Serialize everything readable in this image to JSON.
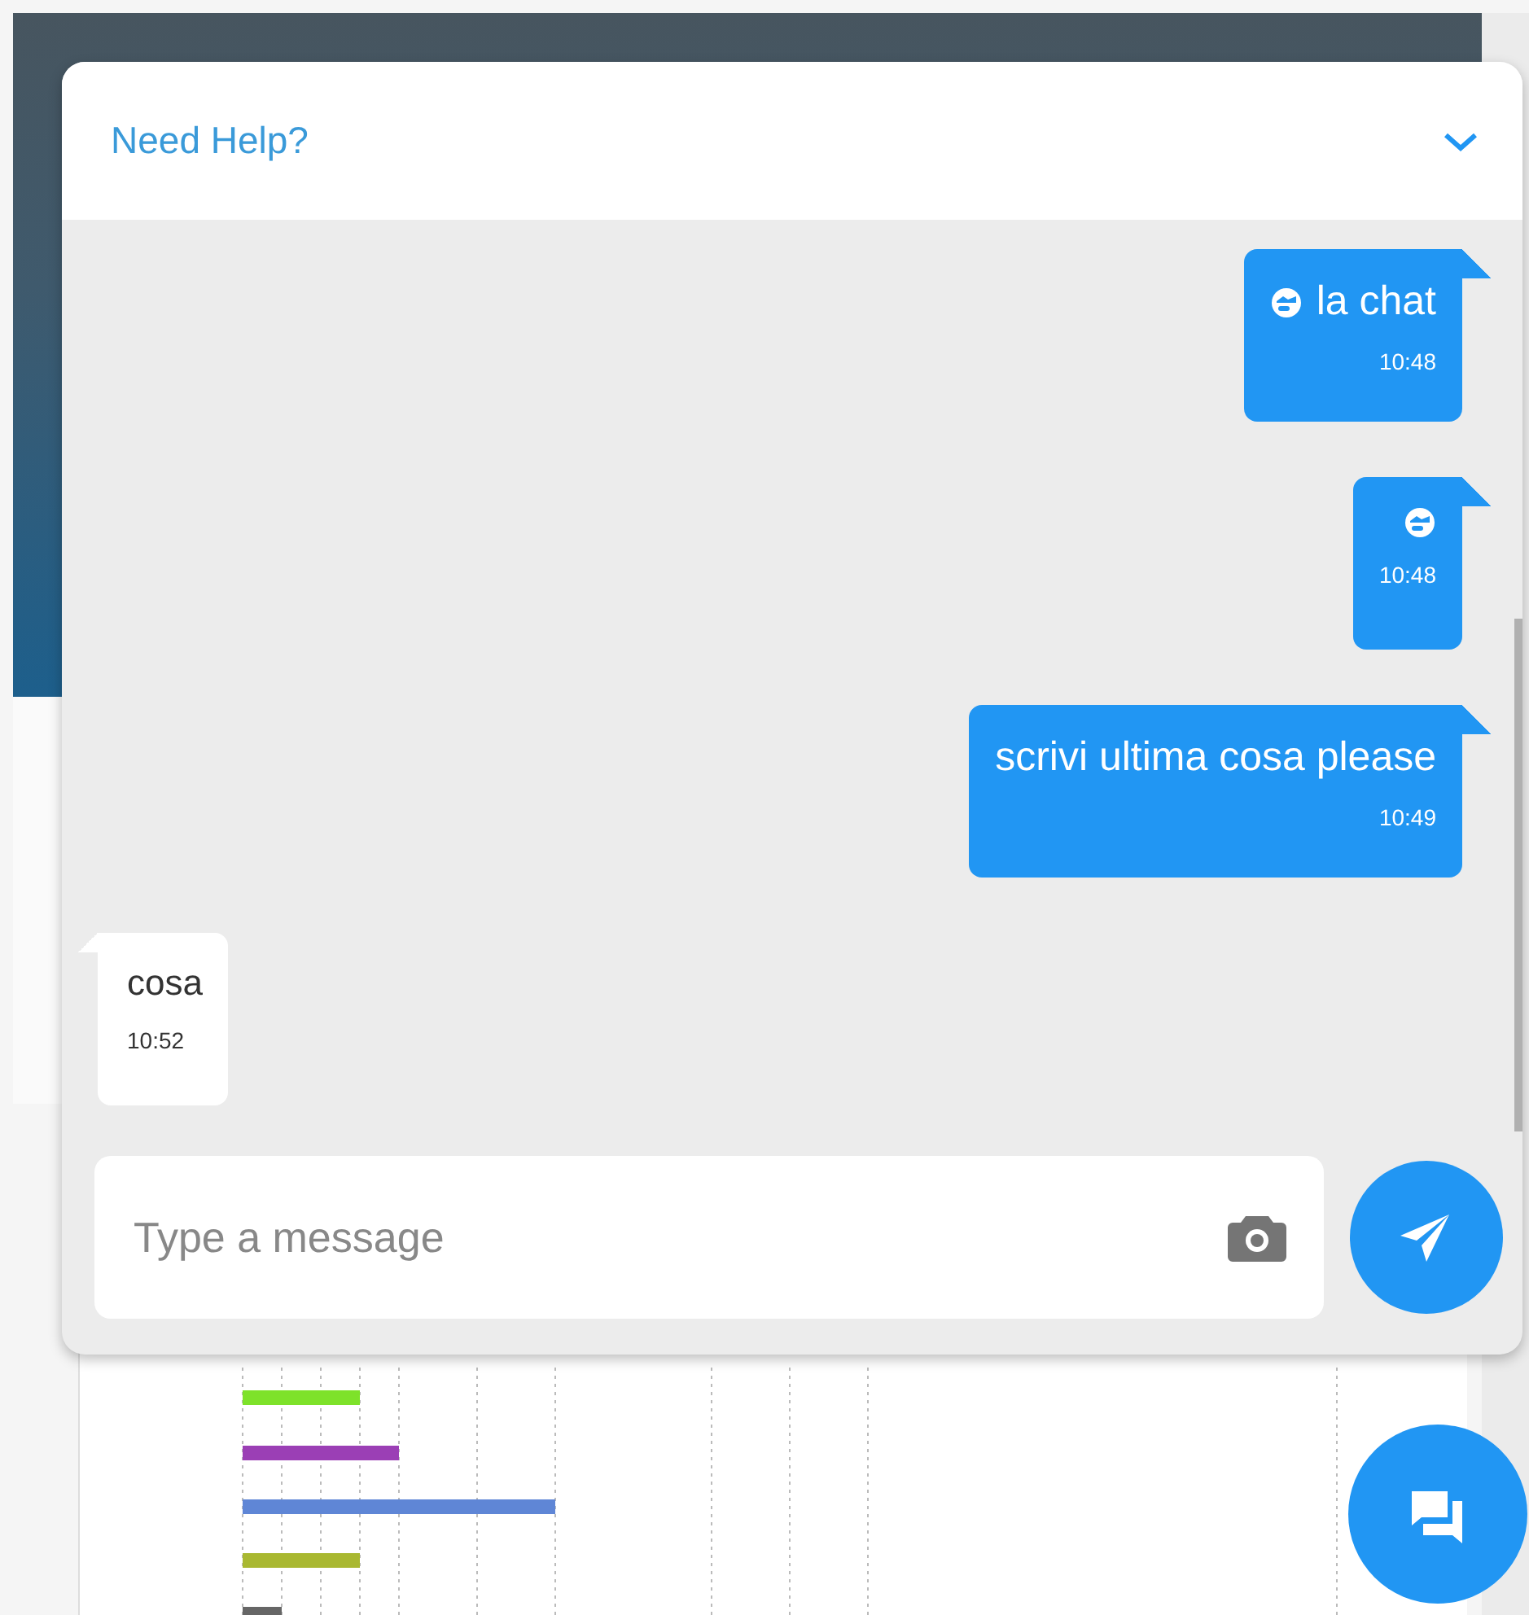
{
  "chat": {
    "title": "Need Help?",
    "messages": [
      {
        "kind": "sent",
        "emoji": true,
        "text": "la chat",
        "time": "10:48"
      },
      {
        "kind": "sent",
        "emoji": true,
        "time": "10:48"
      },
      {
        "kind": "sent",
        "emoji": false,
        "text": "scrivi ultima cosa please",
        "time": "10:49"
      },
      {
        "kind": "received",
        "emoji": false,
        "text": "cosa",
        "time": "10:52"
      }
    ],
    "input": {
      "placeholder": "Type a message"
    }
  }
}
